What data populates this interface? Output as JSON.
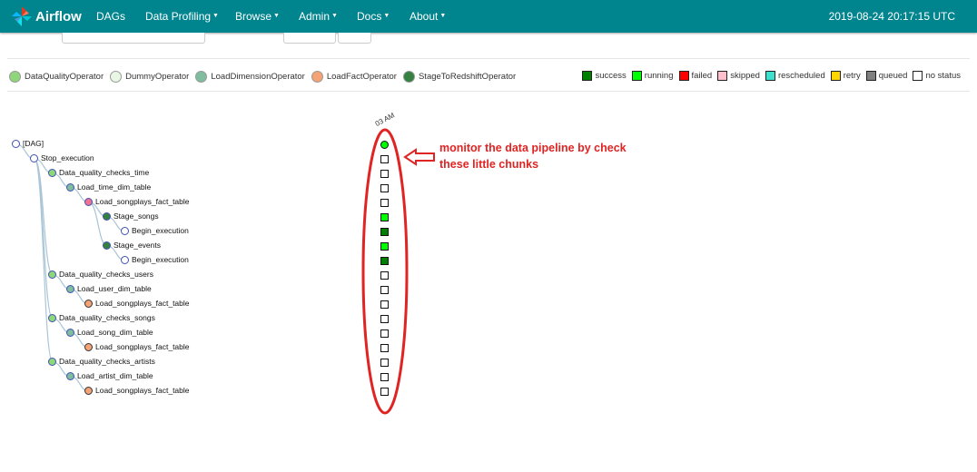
{
  "navbar": {
    "brand": "Airflow",
    "menu": [
      {
        "label": "DAGs",
        "has_caret": false
      },
      {
        "label": "Data Profiling",
        "has_caret": true
      },
      {
        "label": "Browse",
        "has_caret": true
      },
      {
        "label": "Admin",
        "has_caret": true
      },
      {
        "label": "Docs",
        "has_caret": true
      },
      {
        "label": "About",
        "has_caret": true
      }
    ],
    "clock": "2019-08-24 20:17:15 UTC"
  },
  "operator_legend": [
    {
      "label": "DataQualityOperator",
      "color": "#8fd67a"
    },
    {
      "label": "DummyOperator",
      "color": "#e8f7e4"
    },
    {
      "label": "LoadDimensionOperator",
      "color": "#80bd9e"
    },
    {
      "label": "LoadFactOperator",
      "color": "#f4a276"
    },
    {
      "label": "StageToRedshiftOperator",
      "color": "#358140"
    }
  ],
  "status_legend": [
    {
      "label": "success",
      "color": "#008000"
    },
    {
      "label": "running",
      "color": "#00ff00"
    },
    {
      "label": "failed",
      "color": "#ff0000"
    },
    {
      "label": "skipped",
      "color": "#ffc0cb"
    },
    {
      "label": "rescheduled",
      "color": "#40e0d0"
    },
    {
      "label": "retry",
      "color": "#ffd700"
    },
    {
      "label": "queued",
      "color": "#808080"
    },
    {
      "label": "no status",
      "color": "#ffffff"
    }
  ],
  "tree": [
    {
      "label": "[DAG]",
      "depth": 0,
      "fill": "#ffffff",
      "ring": "#3f51b5"
    },
    {
      "label": "Stop_execution",
      "depth": 1,
      "fill": "#ffffff",
      "ring": "#3f51b5"
    },
    {
      "label": "Data_quality_checks_time",
      "depth": 2,
      "fill": "#8fd67a",
      "ring": "#3f51b5"
    },
    {
      "label": "Load_time_dim_table",
      "depth": 3,
      "fill": "#80bd9e",
      "ring": "#3f51b5"
    },
    {
      "label": "Load_songplays_fact_table",
      "depth": 4,
      "fill": "#f07090",
      "ring": "#3f51b5"
    },
    {
      "label": "Stage_songs",
      "depth": 5,
      "fill": "#358140",
      "ring": "#3f51b5"
    },
    {
      "label": "Begin_execution",
      "depth": 6,
      "fill": "#ffffff",
      "ring": "#3f51b5"
    },
    {
      "label": "Stage_events",
      "depth": 5,
      "fill": "#358140",
      "ring": "#3f51b5"
    },
    {
      "label": "Begin_execution",
      "depth": 6,
      "fill": "#ffffff",
      "ring": "#3f51b5"
    },
    {
      "label": "Data_quality_checks_users",
      "depth": 2,
      "fill": "#8fd67a",
      "ring": "#3f51b5"
    },
    {
      "label": "Load_user_dim_table",
      "depth": 3,
      "fill": "#80bd9e",
      "ring": "#3f51b5"
    },
    {
      "label": "Load_songplays_fact_table",
      "depth": 4,
      "fill": "#f4a276",
      "ring": "#333333"
    },
    {
      "label": "Data_quality_checks_songs",
      "depth": 2,
      "fill": "#8fd67a",
      "ring": "#3f51b5"
    },
    {
      "label": "Load_song_dim_table",
      "depth": 3,
      "fill": "#80bd9e",
      "ring": "#3f51b5"
    },
    {
      "label": "Load_songplays_fact_table",
      "depth": 4,
      "fill": "#f4a276",
      "ring": "#333333"
    },
    {
      "label": "Data_quality_checks_artists",
      "depth": 2,
      "fill": "#8fd67a",
      "ring": "#3f51b5"
    },
    {
      "label": "Load_artist_dim_table",
      "depth": 3,
      "fill": "#80bd9e",
      "ring": "#3f51b5"
    },
    {
      "label": "Load_songplays_fact_table",
      "depth": 4,
      "fill": "#f4a276",
      "ring": "#333333"
    }
  ],
  "grid": {
    "date_label": "03 AM",
    "cells": [
      {
        "status": "success",
        "color": "#00ff00",
        "shape": "circle"
      },
      {
        "status": "no status",
        "color": "#ffffff",
        "shape": "square"
      },
      {
        "status": "no status",
        "color": "#ffffff",
        "shape": "square"
      },
      {
        "status": "no status",
        "color": "#ffffff",
        "shape": "square"
      },
      {
        "status": "no status",
        "color": "#ffffff",
        "shape": "square"
      },
      {
        "status": "running",
        "color": "#00ff00",
        "shape": "square"
      },
      {
        "status": "success",
        "color": "#008000",
        "shape": "square"
      },
      {
        "status": "running",
        "color": "#00ff00",
        "shape": "square"
      },
      {
        "status": "success",
        "color": "#008000",
        "shape": "square"
      },
      {
        "status": "no status",
        "color": "#ffffff",
        "shape": "square"
      },
      {
        "status": "no status",
        "color": "#ffffff",
        "shape": "square"
      },
      {
        "status": "no status",
        "color": "#ffffff",
        "shape": "square"
      },
      {
        "status": "no status",
        "color": "#ffffff",
        "shape": "square"
      },
      {
        "status": "no status",
        "color": "#ffffff",
        "shape": "square"
      },
      {
        "status": "no status",
        "color": "#ffffff",
        "shape": "square"
      },
      {
        "status": "no status",
        "color": "#ffffff",
        "shape": "square"
      },
      {
        "status": "no status",
        "color": "#ffffff",
        "shape": "square"
      },
      {
        "status": "no status",
        "color": "#ffffff",
        "shape": "square"
      }
    ]
  },
  "annotation": {
    "line1": "monitor the data pipeline by check",
    "line2": "these little chunks",
    "color": "#e02424"
  }
}
